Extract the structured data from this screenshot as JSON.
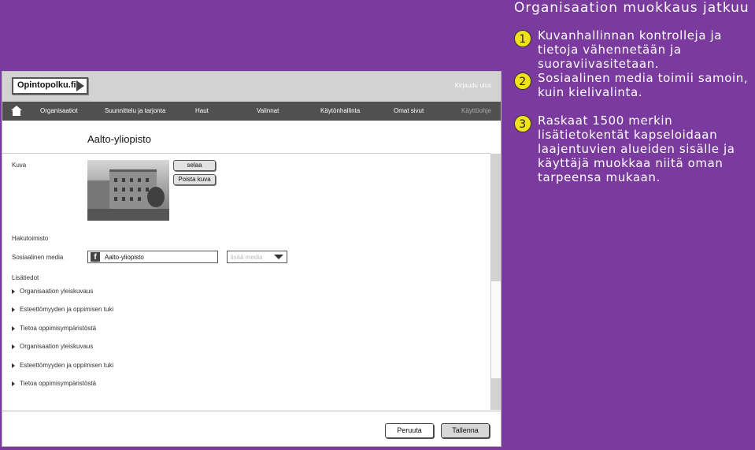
{
  "annotations": {
    "title": "Organisaation muokkaus jatkuu",
    "notes": [
      {
        "num": "1",
        "text": "Kuvanhallinnan kontrolleja ja tietoja vähennetään ja suoraviivasitetaan."
      },
      {
        "num": "2",
        "text": "Sosiaalinen media toimii samoin, kuin kielivalinta."
      },
      {
        "num": "3",
        "text": "Raskaat 1500 merkin lisätietokentät kapseloidaan laajentuvien alueiden sisälle ja käyttäjä muokkaa niitä oman tarpeensa mukaan."
      }
    ]
  },
  "header": {
    "logo": "Opintopolku.fi",
    "logout": "Kirjaudu ulos"
  },
  "nav": {
    "items": [
      "Organisaatiot",
      "Suunnittelu ja tarjonta",
      "Haut",
      "Valinnat",
      "Käytönhallinta",
      "Omat sivut",
      "Käyttöohje"
    ]
  },
  "page": {
    "title": "Aalto-yliopisto",
    "image_label": "Kuva",
    "browse_button": "selaa",
    "remove_button": "Poista kuva",
    "office_label": "Hakutoimisto",
    "social_label": "Sosiaalinen media",
    "social_value": "Aalto-yliopisto",
    "social_select_placeholder": "lisää media",
    "extra_label": "Lisätiedot",
    "sections": [
      "Organisaation yleiskuvaus",
      "Esteettömyyden ja oppimisen tuki",
      "Tietoa oppimisympäristöstä",
      "Organisaation yleiskuvaus",
      "Esteettömyyden ja oppimisen tuki",
      "Tietoa oppimisympäristöstä"
    ]
  },
  "footer": {
    "cancel": "Peruuta",
    "save": "Tallenna"
  },
  "colors": {
    "background": "#7a3a9e",
    "topbar": "#d2d2d2",
    "navbar": "#505050",
    "badge": "#f2e21c"
  }
}
